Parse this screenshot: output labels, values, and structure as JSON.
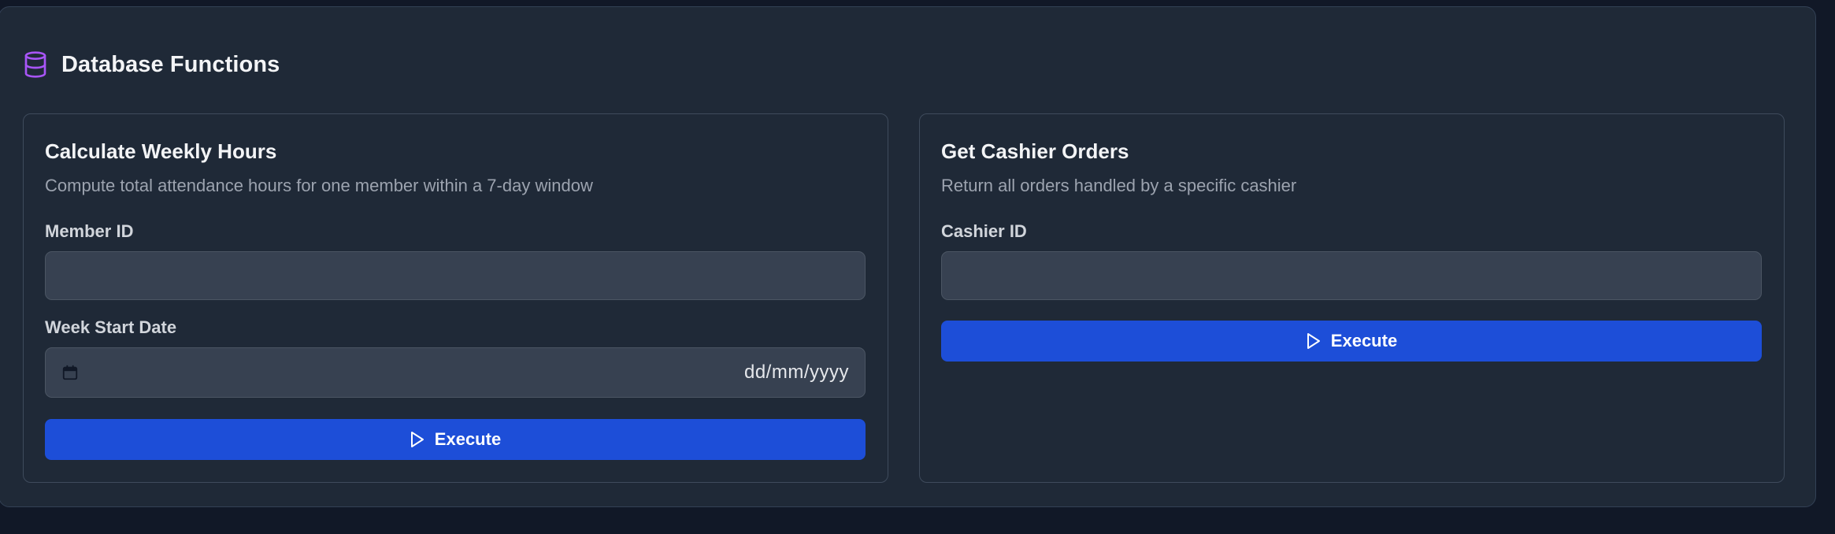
{
  "panel": {
    "title": "Database Functions",
    "icon": "database-icon",
    "accent_color": "#a855f7"
  },
  "weekly_hours": {
    "title": "Calculate Weekly Hours",
    "description": "Compute total attendance hours for one member within a 7-day window",
    "member_id_label": "Member ID",
    "member_id_value": "",
    "week_start_label": "Week Start Date",
    "week_start_placeholder": "dd/mm/yyyy",
    "calendar_icon": "calendar-icon",
    "execute_label": "Execute"
  },
  "cashier_orders": {
    "title": "Get Cashier Orders",
    "description": "Return all orders handled by a specific cashier",
    "cashier_id_label": "Cashier ID",
    "cashier_id_value": "",
    "execute_label": "Execute"
  },
  "colors": {
    "background": "#111827",
    "panel": "#1f2937",
    "input": "#374151",
    "button": "#1d4ed8"
  }
}
